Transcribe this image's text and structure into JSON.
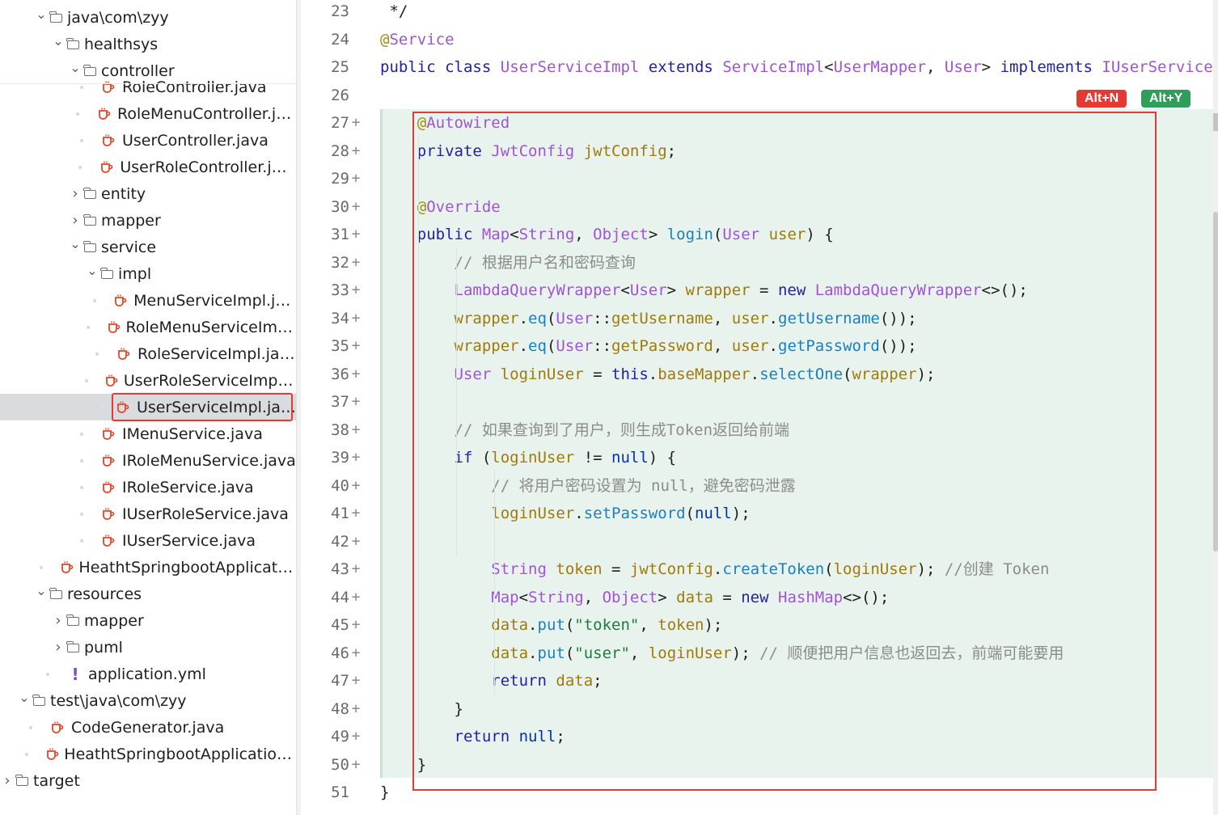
{
  "tree": {
    "items": [
      {
        "label": "java\\com\\zyy",
        "kind": "folder",
        "expanded": true,
        "level": 1
      },
      {
        "label": "healthsys",
        "kind": "folder",
        "expanded": true,
        "level": 2
      },
      {
        "label": "controller",
        "kind": "folder",
        "expanded": true,
        "level": 3
      },
      {
        "label": "RoleController.java",
        "kind": "java",
        "level": 4
      },
      {
        "label": "RoleMenuController.java",
        "kind": "java",
        "level": 4
      },
      {
        "label": "UserController.java",
        "kind": "java",
        "level": 4
      },
      {
        "label": "UserRoleController.java",
        "kind": "java",
        "level": 4
      },
      {
        "label": "entity",
        "kind": "folder",
        "expanded": false,
        "level": 3
      },
      {
        "label": "mapper",
        "kind": "folder",
        "expanded": false,
        "level": 3
      },
      {
        "label": "service",
        "kind": "folder",
        "expanded": true,
        "level": 3
      },
      {
        "label": "impl",
        "kind": "folder",
        "expanded": true,
        "level": 4
      },
      {
        "label": "MenuServiceImpl.java",
        "kind": "java",
        "level": 5
      },
      {
        "label": "RoleMenuServiceImpl.j...",
        "kind": "java",
        "level": 5
      },
      {
        "label": "RoleServiceImpl.java",
        "kind": "java",
        "level": 5
      },
      {
        "label": "UserRoleServiceImpl.java",
        "kind": "java",
        "level": 5
      },
      {
        "label": "UserServiceImpl.java",
        "kind": "java",
        "level": 5,
        "selected": true
      },
      {
        "label": "IMenuService.java",
        "kind": "java",
        "level": 4
      },
      {
        "label": "IRoleMenuService.java",
        "kind": "java",
        "level": 4
      },
      {
        "label": "IRoleService.java",
        "kind": "java",
        "level": 4
      },
      {
        "label": "IUserRoleService.java",
        "kind": "java",
        "level": 4
      },
      {
        "label": "IUserService.java",
        "kind": "java",
        "level": 4
      },
      {
        "label": "HeathtSpringbootApplication.j...",
        "kind": "java",
        "level": 2
      },
      {
        "label": "resources",
        "kind": "folder",
        "expanded": true,
        "level": 1
      },
      {
        "label": "mapper",
        "kind": "folder",
        "expanded": false,
        "level": 2
      },
      {
        "label": "puml",
        "kind": "folder",
        "expanded": false,
        "level": 2
      },
      {
        "label": "application.yml",
        "kind": "yml",
        "level": 2
      },
      {
        "label": "test\\java\\com\\zyy",
        "kind": "folder",
        "expanded": true,
        "level": 0
      },
      {
        "label": "CodeGenerator.java",
        "kind": "java",
        "level": 1
      },
      {
        "label": "HeathtSpringbootApplicationTes...",
        "kind": "java",
        "level": 1
      },
      {
        "label": "target",
        "kind": "folder",
        "expanded": false,
        "level": -1
      }
    ]
  },
  "editor": {
    "hints": {
      "reject": "Alt+N",
      "accept": "Alt+Y"
    },
    "lines": [
      {
        "n": "23",
        "text": " */",
        "added": false
      },
      {
        "n": "24",
        "text": "@Service",
        "added": false
      },
      {
        "n": "25",
        "text": "public class UserServiceImpl extends ServiceImpl<UserMapper, User> implements IUserService",
        "added": false
      },
      {
        "n": "26",
        "text": "",
        "added": false
      },
      {
        "n": "27",
        "text": "    @Autowired",
        "added": true
      },
      {
        "n": "28",
        "text": "    private JwtConfig jwtConfig;",
        "added": true
      },
      {
        "n": "29",
        "text": "",
        "added": true
      },
      {
        "n": "30",
        "text": "    @Override",
        "added": true
      },
      {
        "n": "31",
        "text": "    public Map<String, Object> login(User user) {",
        "added": true
      },
      {
        "n": "32",
        "text": "        // 根据用户名和密码查询",
        "added": true
      },
      {
        "n": "33",
        "text": "        LambdaQueryWrapper<User> wrapper = new LambdaQueryWrapper<>();",
        "added": true
      },
      {
        "n": "34",
        "text": "        wrapper.eq(User::getUsername, user.getUsername());",
        "added": true
      },
      {
        "n": "35",
        "text": "        wrapper.eq(User::getPassword, user.getPassword());",
        "added": true
      },
      {
        "n": "36",
        "text": "        User loginUser = this.baseMapper.selectOne(wrapper);",
        "added": true
      },
      {
        "n": "37",
        "text": "",
        "added": true
      },
      {
        "n": "38",
        "text": "        // 如果查询到了用户，则生成Token返回给前端",
        "added": true
      },
      {
        "n": "39",
        "text": "        if (loginUser != null) {",
        "added": true
      },
      {
        "n": "40",
        "text": "            // 将用户密码设置为 null，避免密码泄露",
        "added": true
      },
      {
        "n": "41",
        "text": "            loginUser.setPassword(null);",
        "added": true
      },
      {
        "n": "42",
        "text": "",
        "added": true
      },
      {
        "n": "43",
        "text": "            String token = jwtConfig.createToken(loginUser); //创建 Token",
        "added": true
      },
      {
        "n": "44",
        "text": "            Map<String, Object> data = new HashMap<>();",
        "added": true
      },
      {
        "n": "45",
        "text": "            data.put(\"token\", token);",
        "added": true
      },
      {
        "n": "46",
        "text": "            data.put(\"user\", loginUser); // 顺便把用户信息也返回去，前端可能要用",
        "added": true
      },
      {
        "n": "47",
        "text": "            return data;",
        "added": true
      },
      {
        "n": "48",
        "text": "        }",
        "added": true
      },
      {
        "n": "49",
        "text": "        return null;",
        "added": true
      },
      {
        "n": "50",
        "text": "    }",
        "added": true
      },
      {
        "n": "51",
        "text": "}",
        "added": false
      }
    ]
  }
}
